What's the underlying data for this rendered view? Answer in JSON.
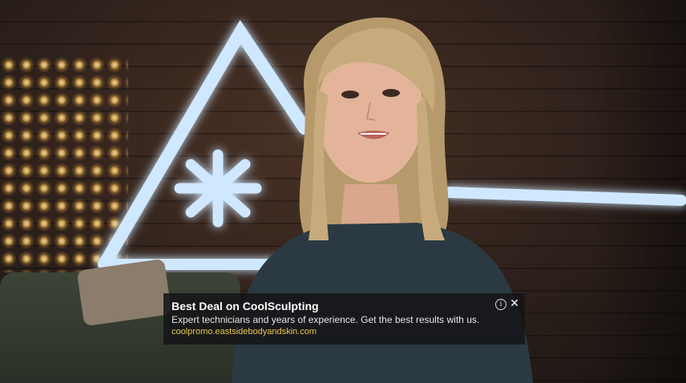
{
  "ad": {
    "title": "Best Deal on CoolSculpting",
    "description": "Expert technicians and years of experience. Get the best results with us.",
    "url": "coolpromo.eastsidebodyandskin.com",
    "info_icon": "info-icon",
    "close_icon": "close-icon",
    "info_glyph": "i",
    "close_glyph": "✕",
    "url_color": "#e8c84a",
    "background_color": "#141416"
  },
  "scene": {
    "neon_color": "#cfe8ff",
    "light_color": "#f0c060"
  }
}
